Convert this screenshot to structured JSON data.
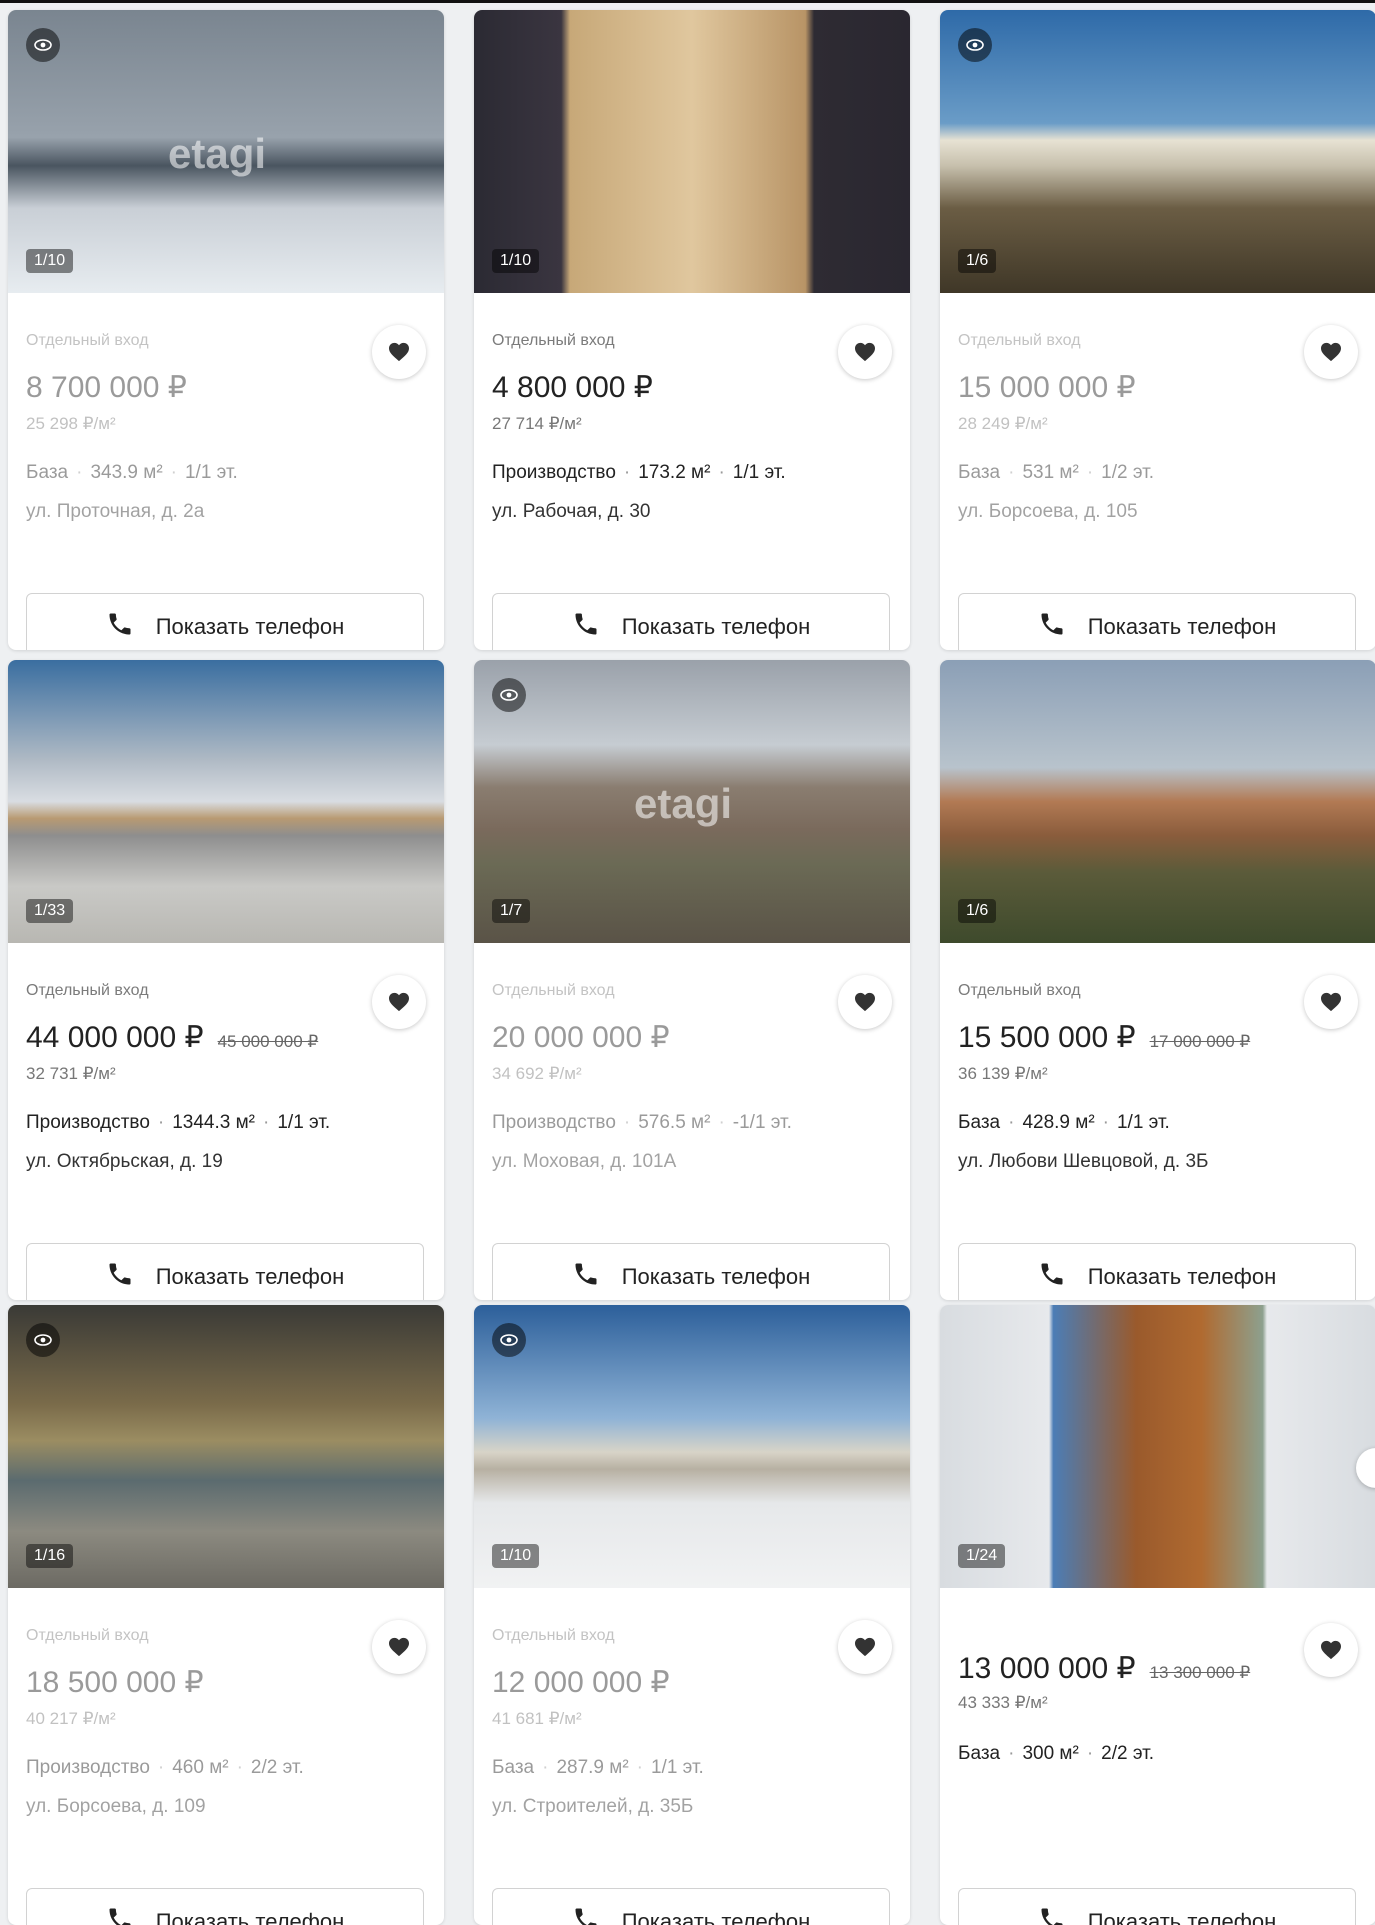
{
  "cards": [
    {
      "tag": "Отдельный вход",
      "price": "8 700 000 ₽",
      "old_price": "",
      "price_per_m2": "25 298 ₽/м²",
      "type": "База",
      "area": "343.9 м²",
      "floor": "1/1 эт.",
      "address": "ул. Проточная, д. 2а",
      "photo_counter": "1/10",
      "has_view_icon": true,
      "watermark": "etagi",
      "faded": true,
      "phone_button": "Показать телефон"
    },
    {
      "tag": "Отдельный вход",
      "price": "4 800 000 ₽",
      "old_price": "",
      "price_per_m2": "27 714 ₽/м²",
      "type": "Производство",
      "area": "173.2 м²",
      "floor": "1/1 эт.",
      "address": "ул. Рабочая, д. 30",
      "photo_counter": "1/10",
      "has_view_icon": false,
      "watermark": "",
      "faded": false,
      "phone_button": "Показать телефон"
    },
    {
      "tag": "Отдельный вход",
      "price": "15 000 000 ₽",
      "old_price": "",
      "price_per_m2": "28 249 ₽/м²",
      "type": "База",
      "area": "531 м²",
      "floor": "1/2 эт.",
      "address": "ул. Борсоева, д. 105",
      "photo_counter": "1/6",
      "has_view_icon": true,
      "watermark": "",
      "faded": true,
      "phone_button": "Показать телефон"
    },
    {
      "tag": "Отдельный вход",
      "price": "44 000 000 ₽",
      "old_price": "45 000 000 ₽",
      "price_per_m2": "32 731 ₽/м²",
      "type": "Производство",
      "area": "1344.3 м²",
      "floor": "1/1 эт.",
      "address": "ул. Октябрьская, д. 19",
      "photo_counter": "1/33",
      "has_view_icon": false,
      "watermark": "",
      "faded": false,
      "phone_button": "Показать телефон"
    },
    {
      "tag": "Отдельный вход",
      "price": "20 000 000 ₽",
      "old_price": "",
      "price_per_m2": "34 692 ₽/м²",
      "type": "Производство",
      "area": "576.5 м²",
      "floor": "-1/1 эт.",
      "address": "ул. Моховая, д. 101А",
      "photo_counter": "1/7",
      "has_view_icon": true,
      "watermark": "etagi",
      "faded": true,
      "phone_button": "Показать телефон"
    },
    {
      "tag": "Отдельный вход",
      "price": "15 500 000 ₽",
      "old_price": "17 000 000 ₽",
      "price_per_m2": "36 139 ₽/м²",
      "type": "База",
      "area": "428.9 м²",
      "floor": "1/1 эт.",
      "address": "ул. Любови Шевцовой, д. 3Б",
      "photo_counter": "1/6",
      "has_view_icon": false,
      "watermark": "",
      "faded": false,
      "phone_button": "Показать телефон"
    },
    {
      "tag": "Отдельный вход",
      "price": "18 500 000 ₽",
      "old_price": "",
      "price_per_m2": "40 217 ₽/м²",
      "type": "Производство",
      "area": "460 м²",
      "floor": "2/2 эт.",
      "address": "ул. Борсоева, д. 109",
      "photo_counter": "1/16",
      "has_view_icon": true,
      "watermark": "",
      "faded": true,
      "phone_button": "Показать телефон"
    },
    {
      "tag": "Отдельный вход",
      "price": "12 000 000 ₽",
      "old_price": "",
      "price_per_m2": "41 681 ₽/м²",
      "type": "База",
      "area": "287.9 м²",
      "floor": "1/1 эт.",
      "address": "ул. Строителей, д. 35Б",
      "photo_counter": "1/10",
      "has_view_icon": true,
      "watermark": "",
      "faded": true,
      "phone_button": "Показать телефон"
    },
    {
      "tag": "",
      "price": "13 000 000 ₽",
      "old_price": "13 300 000 ₽",
      "price_per_m2": "43 333 ₽/м²",
      "type": "База",
      "area": "300 м²",
      "floor": "2/2 эт.",
      "address": "",
      "photo_counter": "1/24",
      "has_view_icon": false,
      "watermark": "",
      "faded": false,
      "phone_button": "Показать телефон"
    }
  ]
}
